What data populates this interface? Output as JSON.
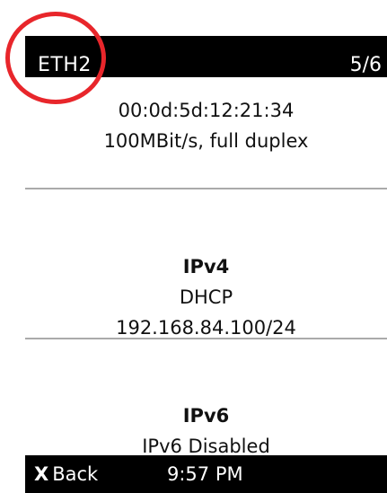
{
  "header": {
    "title": "ETH2",
    "page_indicator": "5/6"
  },
  "link": {
    "mac": "00:0d:5d:12:21:34",
    "speed": "100MBit/s, full duplex"
  },
  "ipv4": {
    "heading": "IPv4",
    "mode": "DHCP",
    "address": "192.168.84.100/24"
  },
  "ipv6": {
    "heading": "IPv6",
    "status": "IPv6 Disabled"
  },
  "footer": {
    "back_icon": "X",
    "back_label": "Back",
    "time": "9:57 PM"
  },
  "colors": {
    "bar_background": "#000000",
    "highlight": "#e8262b",
    "divider": "#aaaaaa"
  }
}
